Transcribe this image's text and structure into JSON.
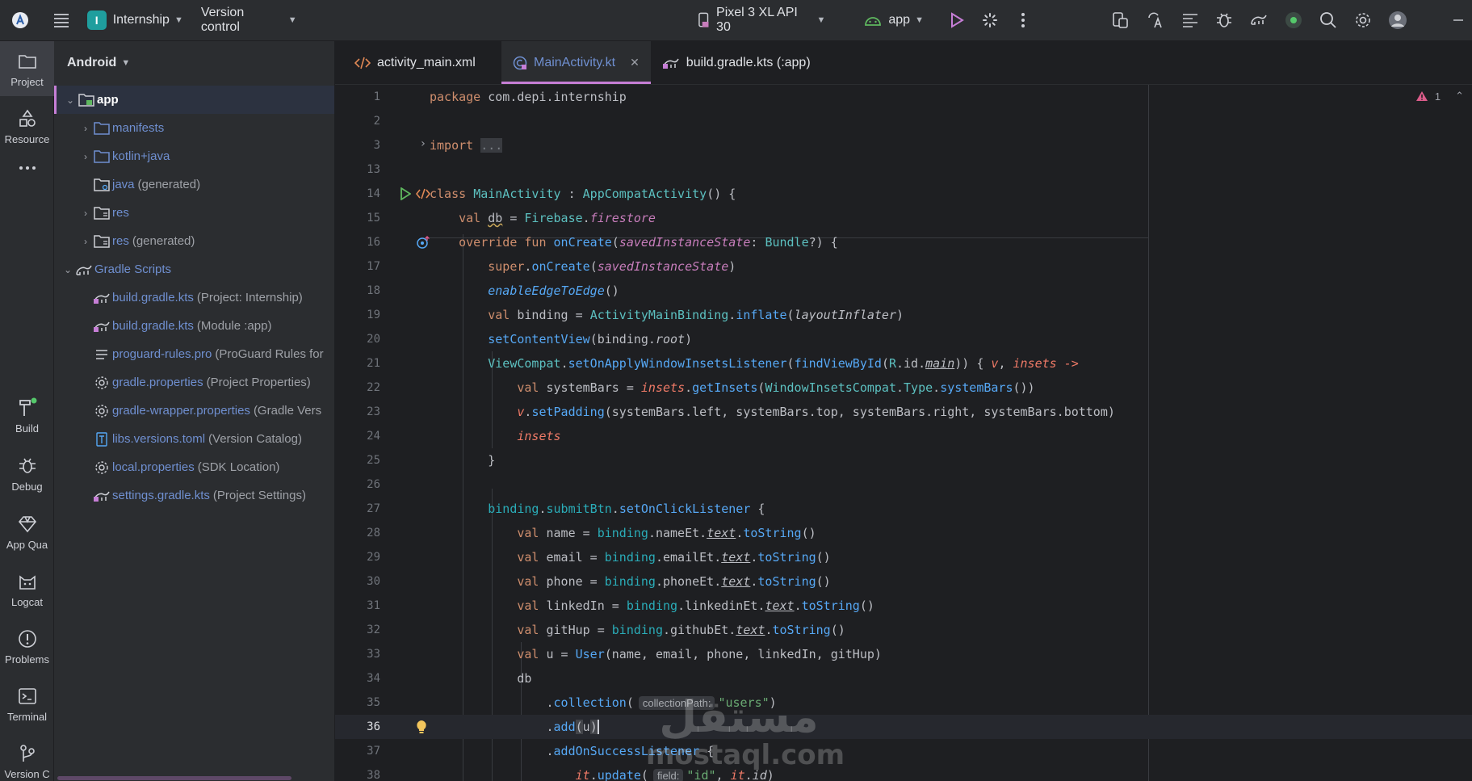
{
  "titlebar": {
    "project_initial": "I",
    "project_name": "Internship",
    "vcs_label": "Version control",
    "device": "Pixel 3 XL API 30",
    "run_config": "app"
  },
  "toolstrip": {
    "project": "Project",
    "resources": "Resource",
    "build": "Build",
    "debug": "Debug",
    "app_quality": "App Qua",
    "logcat": "Logcat",
    "problems": "Problems",
    "terminal": "Terminal",
    "version_control": "Version C"
  },
  "project_panel": {
    "view_mode": "Android",
    "rows": [
      {
        "name": "app",
        "hint": ""
      },
      {
        "name": "manifests",
        "hint": ""
      },
      {
        "name": "kotlin+java",
        "hint": ""
      },
      {
        "name": "java",
        "hint": "(generated)"
      },
      {
        "name": "res",
        "hint": ""
      },
      {
        "name": "res",
        "hint": "(generated)"
      },
      {
        "name": "Gradle Scripts",
        "hint": ""
      },
      {
        "name": "build.gradle.kts",
        "hint": "(Project: Internship)"
      },
      {
        "name": "build.gradle.kts",
        "hint": "(Module :app)"
      },
      {
        "name": "proguard-rules.pro",
        "hint": "(ProGuard Rules for"
      },
      {
        "name": "gradle.properties",
        "hint": "(Project Properties)"
      },
      {
        "name": "gradle-wrapper.properties",
        "hint": "(Gradle Vers"
      },
      {
        "name": "libs.versions.toml",
        "hint": "(Version Catalog)"
      },
      {
        "name": "local.properties",
        "hint": "(SDK Location)"
      },
      {
        "name": "settings.gradle.kts",
        "hint": "(Project Settings)"
      }
    ]
  },
  "tabs": [
    {
      "label": "activity_main.xml"
    },
    {
      "label": "MainActivity.kt"
    },
    {
      "label": "build.gradle.kts (:app)"
    }
  ],
  "editor": {
    "warning_count": "1",
    "line_numbers": [
      "1",
      "2",
      "3",
      "13",
      "14",
      "15",
      "16",
      "17",
      "18",
      "19",
      "20",
      "21",
      "22",
      "23",
      "24",
      "25",
      "26",
      "27",
      "28",
      "29",
      "30",
      "31",
      "32",
      "33",
      "34",
      "35",
      "36",
      "37",
      "38"
    ],
    "inlay_collection": "collectionPath:",
    "inlay_update": "field:"
  },
  "watermark": {
    "arabic": "مستقل",
    "latin": "mostaql.com"
  },
  "colors": {
    "accent": "#c67ed6",
    "link": "#6f8fd0",
    "keyword": "#cf8e6d",
    "function": "#56a8f5",
    "string": "#6aab73"
  }
}
